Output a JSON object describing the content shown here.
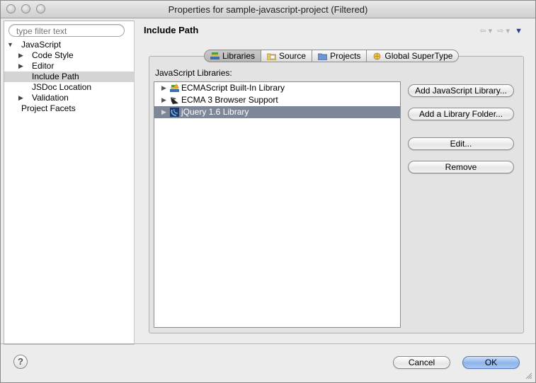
{
  "window": {
    "title": "Properties for sample-javascript-project (Filtered)"
  },
  "filter": {
    "placeholder": "type filter text"
  },
  "tree": [
    {
      "label": "JavaScript",
      "indent": 0,
      "toggle": "down"
    },
    {
      "label": "Code Style",
      "indent": 1,
      "toggle": "right"
    },
    {
      "label": "Editor",
      "indent": 1,
      "toggle": "right"
    },
    {
      "label": "Include Path",
      "indent": 1,
      "toggle": "none",
      "selected": true
    },
    {
      "label": "JSDoc Location",
      "indent": 1,
      "toggle": "none"
    },
    {
      "label": "Validation",
      "indent": 1,
      "toggle": "right"
    },
    {
      "label": "Project Facets",
      "indent": 0,
      "toggle": "none"
    }
  ],
  "page": {
    "title": "Include Path"
  },
  "tabs": [
    {
      "label": "Libraries",
      "icon": "libraries-icon",
      "active": true
    },
    {
      "label": "Source",
      "icon": "source-folder-icon"
    },
    {
      "label": "Projects",
      "icon": "projects-icon"
    },
    {
      "label": "Global SuperType",
      "icon": "global-supertype-icon"
    }
  ],
  "libraries": {
    "label": "JavaScript Libraries:",
    "items": [
      {
        "label": "ECMAScript Built-In Library",
        "icon": "ecmascript-library-icon"
      },
      {
        "label": "ECMA 3 Browser Support",
        "icon": "browser-support-icon"
      },
      {
        "label": "jQuery 1.6 Library",
        "icon": "jquery-icon",
        "selected": true
      }
    ]
  },
  "buttons": {
    "add_js_library": "Add JavaScript Library...",
    "add_library_folder": "Add a Library Folder...",
    "edit": "Edit...",
    "remove": "Remove",
    "cancel": "Cancel",
    "ok": "OK",
    "help": "?"
  },
  "colors": {
    "selection": "#7e8797",
    "default_button": "#8db4ea"
  }
}
